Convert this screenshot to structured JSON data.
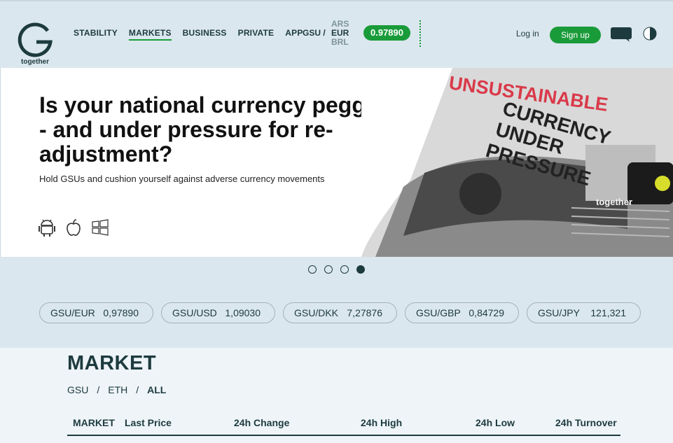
{
  "header": {
    "logo_letter": "G",
    "logo_text": "together",
    "nav": [
      "STABILITY",
      "MARKETS",
      "BUSINESS",
      "PRIVATE",
      "APP"
    ],
    "nav_active": "MARKETS",
    "gsu_label": "GSU /",
    "currencies": [
      "ARS",
      "EUR",
      "BRL"
    ],
    "currency_active": "EUR",
    "rate": "0.97890",
    "login": "Log in",
    "signup": "Sign up"
  },
  "banner": {
    "headline": "Is your national currency pegged - and under pressure for re-adjustment?",
    "subline": "Hold GSUs and cushion yourself against adverse currency movements",
    "paper_headline_1": "UNSUSTAINABLE",
    "paper_headline_2": "CURRENCY",
    "paper_headline_3": "UNDER",
    "paper_headline_4": "PRESSURE",
    "paper_brand": "together"
  },
  "carousel": {
    "count": 4,
    "active_index": 3
  },
  "tickers": [
    {
      "pair": "GSU/EUR",
      "value": "0,97890"
    },
    {
      "pair": "GSU/USD",
      "value": "1,09030"
    },
    {
      "pair": "GSU/DKK",
      "value": "7,27876"
    },
    {
      "pair": "GSU/GBP",
      "value": "0,84729"
    },
    {
      "pair": "GSU/JPY",
      "value": "121,321"
    }
  ],
  "market": {
    "title": "MARKET",
    "crumbs": [
      "GSU",
      "ETH",
      "ALL"
    ],
    "crumb_active": "ALL",
    "columns": [
      "MARKET",
      "Last Price",
      "24h Change",
      "24h High",
      "24h Low",
      "24h Turnover"
    ]
  },
  "colors": {
    "accent": "#1a9b3a",
    "dark": "#1d3b3f",
    "bg": "#dbe7ee"
  }
}
